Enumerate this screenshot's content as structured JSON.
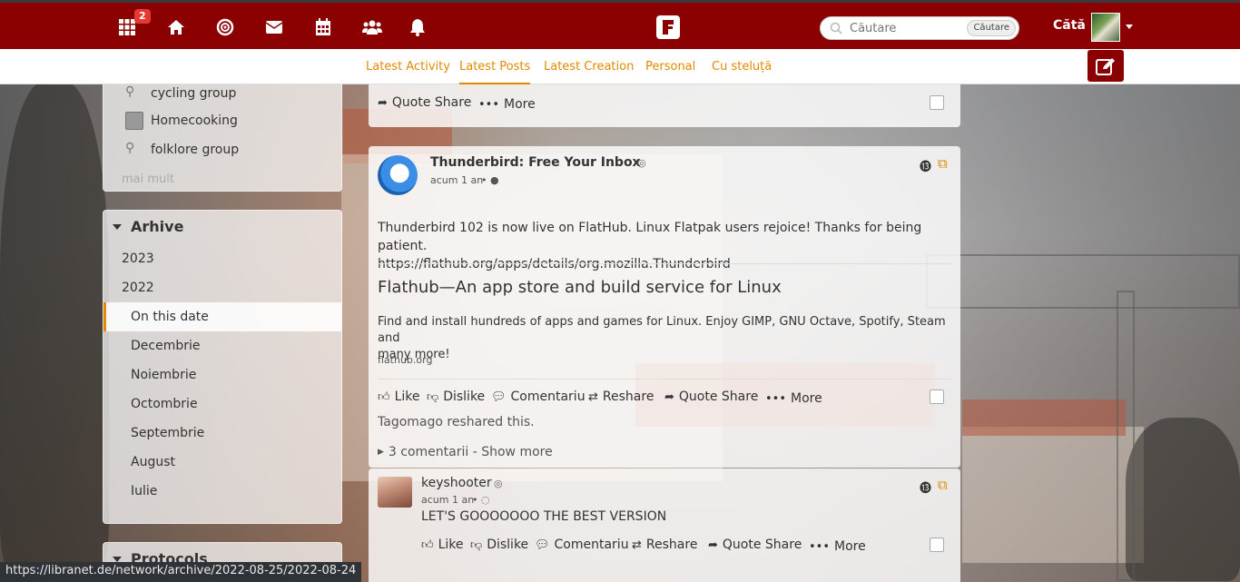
{
  "topbar": {
    "notification_count": "2",
    "search_placeholder": "Căutare",
    "search_button": "Căutare",
    "username": "Cătă"
  },
  "tabs": [
    {
      "label": "Latest Activity"
    },
    {
      "label": "Latest Posts",
      "active": true
    },
    {
      "label": "Latest Creation"
    },
    {
      "label": "Personal"
    },
    {
      "label": "Cu steluță"
    }
  ],
  "sidebar": {
    "groups": [
      {
        "label": "cycling group"
      },
      {
        "label": "Homecooking"
      },
      {
        "label": "folklore group"
      }
    ],
    "more": "mai mult",
    "archive": {
      "title": "Arhive",
      "years": [
        "2023",
        "2022"
      ],
      "months": [
        "On this date",
        "Decembrie",
        "Noiembrie",
        "Octombrie",
        "Septembrie",
        "August",
        "Iulie"
      ],
      "selected": "On this date"
    },
    "next_panel_title": "Protocols"
  },
  "previous_post": {
    "quote_share": "Quote Share",
    "more": "More"
  },
  "post": {
    "author": "Thunderbird: Free Your Inbox",
    "time": "acum 1 an",
    "body_line1": "Thunderbird 102 is now live on FlatHub. Linux Flatpak users rejoice! Thanks for being patient.",
    "body_line2": "https://flathub.org/apps/details/org.mozilla.Thunderbird",
    "card_title": "Flathub—An app store and build service for Linux",
    "card_desc_line1": "Find and install hundreds of apps and games for Linux. Enjoy GIMP, GNU Octave, Spotify, Steam and",
    "card_desc_line2": "many more!",
    "card_domain": "flathub.org",
    "actions": {
      "like": "Like",
      "dislike": "Dislike",
      "comment": "Comentariu",
      "reshare": "Reshare",
      "quote_share": "Quote Share",
      "more": "More"
    },
    "reshared_by": "Tagomago reshared this.",
    "comments_toggle": "3 comentarii - Show more"
  },
  "comment": {
    "author": "keyshooter",
    "time": "acum 1 an",
    "body": "LET'S GOOOOOOO THE BEST VERSION",
    "actions": {
      "like": "Like",
      "dislike": "Dislike",
      "comment": "Comentariu",
      "reshare": "Reshare",
      "quote_share": "Quote Share",
      "more": "More"
    }
  },
  "statusbar": {
    "url": "https://libranet.de/network/archive/2022-08-25/2022-08-24"
  },
  "colors": {
    "brand": "#8b0000",
    "accent": "#e08a00"
  }
}
